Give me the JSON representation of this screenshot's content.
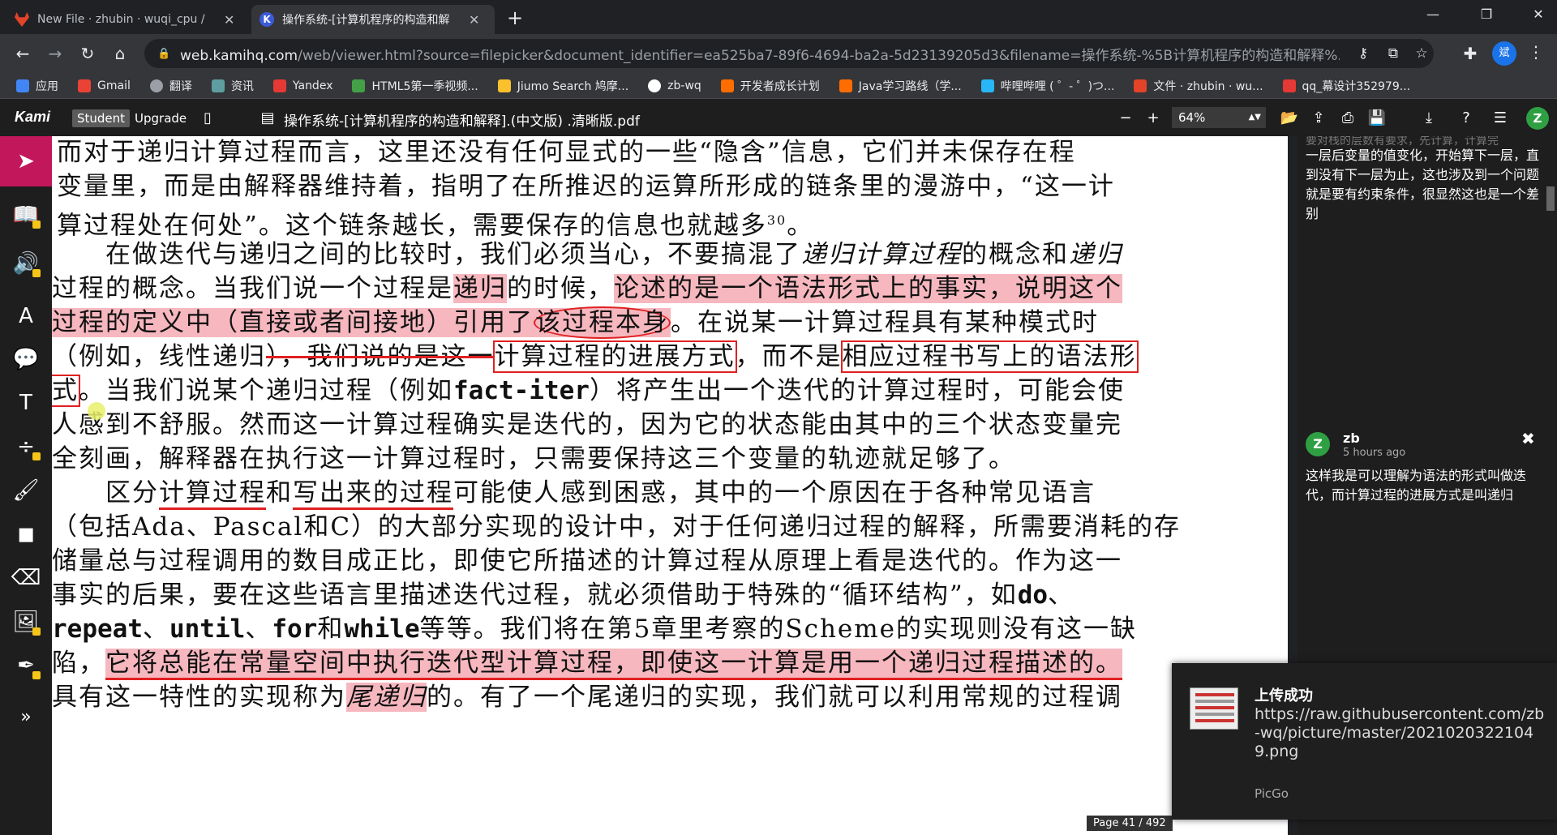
{
  "browser": {
    "tabs": [
      {
        "title": "New File · zhubin · wuqi_cpu /",
        "favicon_color": "#e24329"
      },
      {
        "title": "操作系统-[计算机程序的构造和解",
        "favicon_color": "#3b5bdb",
        "favicon_letter": "K"
      }
    ],
    "new_tab": "+",
    "url_main": "web.kamihq.com",
    "url_rest": "/web/viewer.html?source=filepicker&document_identifier=ea525ba7-89f6-4694-ba2a-5d23139205d3&filename=操作系统-%5B计算机程序的构造和解释%...",
    "profile_letter": "斌",
    "bookmarks": [
      {
        "label": "应用",
        "color": "#4285f4"
      },
      {
        "label": "Gmail",
        "color": "#ea4335"
      },
      {
        "label": "翻译",
        "color": "#9aa0a6"
      },
      {
        "label": "资讯",
        "color": "#5f9ea0"
      },
      {
        "label": "Yandex",
        "color": "#e53935"
      },
      {
        "label": "HTML5第一季视频...",
        "color": "#43a047"
      },
      {
        "label": "Jiumo Search 鸠摩...",
        "color": "#fbc02d"
      },
      {
        "label": "zb-wq",
        "color": "#ffffff"
      },
      {
        "label": "开发者成长计划",
        "color": "#ff6d00"
      },
      {
        "label": "Java学习路线（学...",
        "color": "#ff6d00"
      },
      {
        "label": "哔哩哔哩 ( ゜- ゜)つ...",
        "color": "#29b6f6"
      },
      {
        "label": "文件 · zhubin · wu...",
        "color": "#e24329"
      },
      {
        "label": "qq_幕设计352979...",
        "color": "#e53935"
      }
    ]
  },
  "kami": {
    "logo": "Kami",
    "student": "Student",
    "upgrade": "Upgrade",
    "doc_title": "操作系统-[计算机程序的构造和解释].(中文版) .清晰版.pdf",
    "zoom": "64%",
    "avatar": "Z"
  },
  "document": {
    "lines": [
      [
        "而对于递归计算过程而言，这里还没有任何显式的一些“隐含”信息，它们并未保存在程"
      ],
      [
        "变量里，而是由解释器维持着，指明了在所推迟的运算所形成的链条里的漫游中，“这一计"
      ],
      [
        "算过程处在何处”。这个链条越长，需要保存的信息也就越多",
        "30",
        "。"
      ],
      [
        "在做迭代与递归之间的比较时，我们必须当心，不要搞混了",
        "递归计算过程",
        "的概念和",
        "递归"
      ],
      [
        "过程的概念。当我们说一个过程是",
        "递归",
        "的时候，",
        "论述的是一个语法形式上的事实",
        "，",
        "说明这个"
      ],
      [
        "过程的定义中（直接或者间接地）引用了",
        "该过程本身",
        "。在说某一计算过程具有某种模式时"
      ],
      [
        "（例如，线性递归",
        "），我们说的是这一",
        "计算过程的进展方式",
        "，而不是",
        "相应过程书写上的语法形"
      ],
      [
        "式",
        "。当我们说某个递归过程（例如",
        "fact-iter",
        "）将产生出一个迭代的计算过程时，可能会使"
      ],
      [
        "人感到不舒服。然而这一计算过程确实是迭代的，因为它的状态能由其中的三个状态变量完"
      ],
      [
        "全刻画，解释器在执行这一计算过程时，只需要保持这三个变量的轨迹就足够了。"
      ],
      [
        "区分",
        "计算过程",
        "和",
        "写出来的过程",
        "可能使人感到困惑，其中的一个原因在于各种常见语言"
      ],
      [
        "（包括Ada、Pascal和C）的大部分实现的设计中，对于任何递归过程的解释，所需要消耗的存"
      ],
      [
        "储量总与过程调用的数目成正比，即使它所描述的计算过程从原理上看是迭代的。作为这一"
      ],
      [
        "事实的后果，要在这些语言里描述迭代过程，就必须借助于特殊的“循环结构”，如",
        "do",
        "、"
      ],
      [
        "repeat",
        "、",
        "until",
        "、",
        "for",
        "和",
        "while",
        "等等。我们将在第5章里考察的Scheme的实现则没有这一缺"
      ],
      [
        "陷，",
        "它将总能在常量空间中执行迭代型计算过程，即使这一计算是用一个递归过程描述的。"
      ],
      [
        "具有这一特性的实现称为",
        "尾递归",
        "的。有了一个尾递归的实现，我们就可以利用常规的过程调"
      ]
    ]
  },
  "comments": {
    "first_text": "一层后变量的值变化，开始算下一层，直到没有下一层为止，这也涉及到一个问题就是要有约束条件，很显然这也是一个差别",
    "first_text_top": "要对栈的层数有要求，先计算，计算完",
    "second": {
      "avatar": "Z",
      "name": "zb",
      "time": "5 hours ago",
      "close": "✖",
      "text": "这样我是可以理解为语法的形式叫做迭代，而计算过程的进展方式是叫递归"
    }
  },
  "toast": {
    "title": "上传成功",
    "body": "https://raw.githubusercontent.com/zb-wq/picture/master/20210203221049.png",
    "app": "PicGo"
  },
  "pager": {
    "label": "Page",
    "current": "41",
    "total": "/ 492"
  }
}
